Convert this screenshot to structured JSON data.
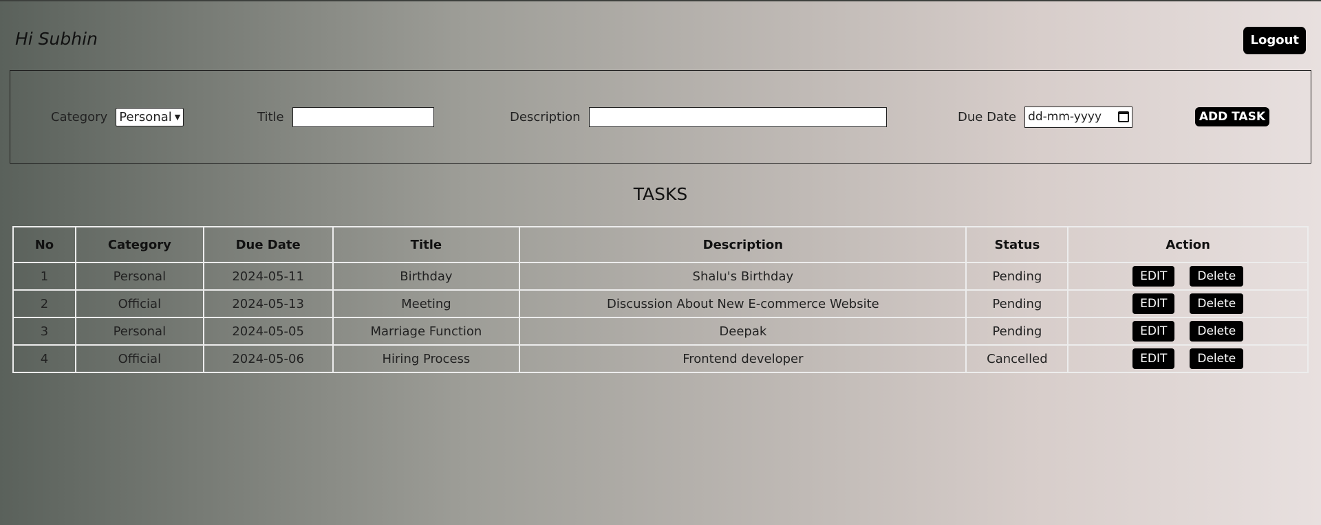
{
  "header": {
    "greeting": "Hi Subhin",
    "logout_label": "Logout"
  },
  "form": {
    "category_label": "Category",
    "category_selected": "Personal",
    "title_label": "Title",
    "title_value": "",
    "description_label": "Description",
    "description_value": "",
    "due_date_label": "Due Date",
    "due_date_placeholder": "dd-mm-yyyy",
    "add_button_label": "ADD TASK"
  },
  "tasks_heading": "TASKS",
  "table": {
    "headers": [
      "No",
      "Category",
      "Due Date",
      "Title",
      "Description",
      "Status",
      "Action"
    ],
    "rows": [
      {
        "no": "1",
        "category": "Personal",
        "due_date": "2024-05-11",
        "title": "Birthday",
        "description": "Shalu's Birthday",
        "status": "Pending"
      },
      {
        "no": "2",
        "category": "Official",
        "due_date": "2024-05-13",
        "title": "Meeting",
        "description": "Discussion About New E-commerce Website",
        "status": "Pending"
      },
      {
        "no": "3",
        "category": "Personal",
        "due_date": "2024-05-05",
        "title": "Marriage Function",
        "description": "Deepak",
        "status": "Pending"
      },
      {
        "no": "4",
        "category": "Official",
        "due_date": "2024-05-06",
        "title": "Hiring Process",
        "description": "Frontend developer",
        "status": "Cancelled"
      }
    ],
    "edit_label": "EDIT",
    "delete_label": "Delete"
  },
  "icons": {
    "select_arrow": "chevron-down-icon",
    "date_picker": "calendar-icon"
  },
  "colors": {
    "button_bg": "#000000",
    "button_text": "#ffffff",
    "table_border": "#ededed"
  }
}
